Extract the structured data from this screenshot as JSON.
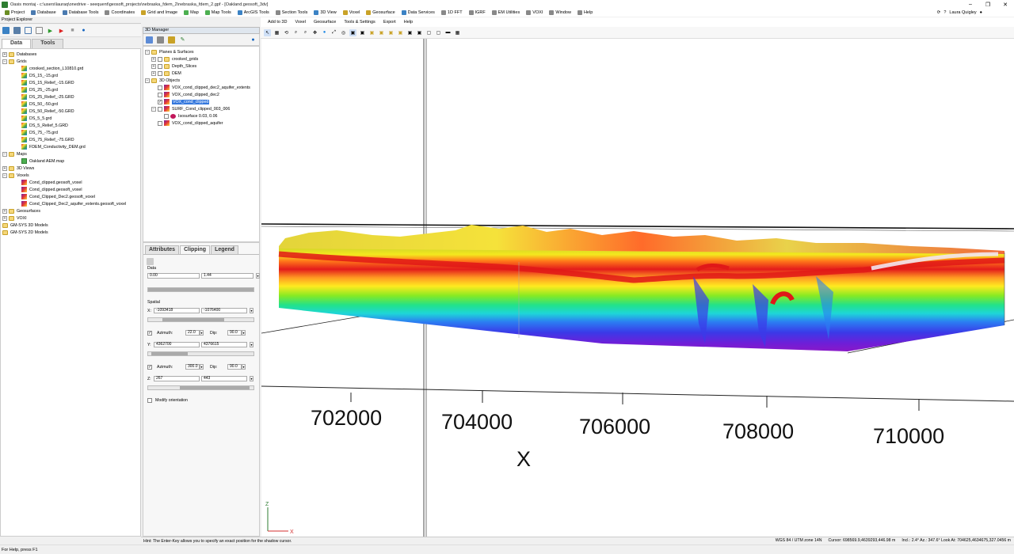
{
  "window": {
    "title": "Oasis montaj - c:\\users\\lauraq\\onedrive - seequent\\geosoft_projects\\nebraska_fdem_2\\nebraska_fdem_2.gpf - [Oakland.geosoft_3dv]",
    "controls": [
      "–",
      "❐",
      "✕"
    ]
  },
  "menu": {
    "items": [
      "Project",
      "Database",
      "Database Tools",
      "Coordinates",
      "Grid and Image",
      "Map",
      "Map Tools",
      "ArcGIS Tools",
      "Section Tools",
      "3D View",
      "Voxel",
      "Geosurface",
      "Data Services",
      "1D FFT",
      "IGRF",
      "EM Utilities",
      "VOXI",
      "Window",
      "Help"
    ],
    "user": "Laura Quigley"
  },
  "project_explorer": {
    "header": "Project Explorer",
    "tabs": [
      "Data",
      "Tools"
    ],
    "tree": [
      {
        "label": "Databases",
        "level": 0,
        "expander": "+",
        "icon": "folder"
      },
      {
        "label": "Grids",
        "level": 0,
        "expander": "−",
        "icon": "folder"
      },
      {
        "label": "crooked_section_L10810.grd",
        "level": 2,
        "icon": "grid"
      },
      {
        "label": "DS_15_-15.grd",
        "level": 2,
        "icon": "grid"
      },
      {
        "label": "DS_15_Relief_-15.GRD",
        "level": 2,
        "icon": "grid"
      },
      {
        "label": "DS_25_-25.grd",
        "level": 2,
        "icon": "grid"
      },
      {
        "label": "DS_25_Relief_-25.GRD",
        "level": 2,
        "icon": "grid"
      },
      {
        "label": "DS_50_-50.grd",
        "level": 2,
        "icon": "grid"
      },
      {
        "label": "DS_50_Relief_-50.GRD",
        "level": 2,
        "icon": "grid"
      },
      {
        "label": "DS_5_5.grd",
        "level": 2,
        "icon": "grid"
      },
      {
        "label": "DS_5_Relief_5.GRD",
        "level": 2,
        "icon": "grid"
      },
      {
        "label": "DS_75_-75.grd",
        "level": 2,
        "icon": "grid"
      },
      {
        "label": "DS_75_Relief_-75.GRD",
        "level": 2,
        "icon": "grid"
      },
      {
        "label": "FDEM_Conductivity_DEM.grd",
        "level": 2,
        "icon": "grid"
      },
      {
        "label": "Maps",
        "level": 0,
        "expander": "−",
        "icon": "folder"
      },
      {
        "label": "Oakland AEM.map",
        "level": 2,
        "icon": "map"
      },
      {
        "label": "3D Views",
        "level": 0,
        "expander": "+",
        "icon": "folder"
      },
      {
        "label": "Voxels",
        "level": 0,
        "expander": "−",
        "icon": "folder"
      },
      {
        "label": "Cond_clipped.geosoft_voxel",
        "level": 2,
        "icon": "cube"
      },
      {
        "label": "Cond_clipped.geosoft_voxel",
        "level": 2,
        "icon": "cube"
      },
      {
        "label": "Cond_Clipped_Dec2.geosoft_voxel",
        "level": 2,
        "icon": "cube"
      },
      {
        "label": "Cond_Clipped_Dec2_aquifer_extents.geosoft_voxel",
        "level": 2,
        "icon": "cube"
      },
      {
        "label": "Geosurfaces",
        "level": 0,
        "expander": "+",
        "icon": "folder"
      },
      {
        "label": "VOXI",
        "level": 0,
        "expander": "+",
        "icon": "folder"
      },
      {
        "label": "GM-SYS 3D Models",
        "level": 0,
        "icon": "folder"
      },
      {
        "label": "GM-SYS 2D Models",
        "level": 0,
        "icon": "folder"
      }
    ]
  },
  "manager_3d": {
    "header": "3D Manager",
    "tree": [
      {
        "label": "Planes & Surfaces",
        "level": 0,
        "expander": "−",
        "icon": "folder"
      },
      {
        "label": "crooked_grids",
        "level": 1,
        "expander": "+",
        "check": false,
        "icon": "folder"
      },
      {
        "label": "Depth_Slices",
        "level": 1,
        "expander": "+",
        "check": false,
        "icon": "folder"
      },
      {
        "label": "DEM",
        "level": 1,
        "expander": "+",
        "check": false,
        "icon": "folder"
      },
      {
        "label": "3D Objects",
        "level": 0,
        "expander": "−",
        "icon": "folder"
      },
      {
        "label": "VOX_cond_clipped_dec2_aquifer_extents",
        "level": 1,
        "check": false,
        "icon": "cube"
      },
      {
        "label": "VOX_cond_clipped_dec2",
        "level": 1,
        "check": false,
        "icon": "cube"
      },
      {
        "label": "VOX_cond_clipped",
        "level": 1,
        "check": true,
        "icon": "cube",
        "selected": true
      },
      {
        "label": "SURF_Cond_clipped_003_006",
        "level": 1,
        "expander": "−",
        "check": false,
        "icon": "cube"
      },
      {
        "label": "Isosurface 0.03, 0.06",
        "level": 2,
        "check": false,
        "icon": "iso"
      },
      {
        "label": "VOX_cond_clipped_aquifer",
        "level": 1,
        "check": false,
        "icon": "cube"
      }
    ]
  },
  "props": {
    "tabs": [
      "Attributes",
      "Clipping",
      "Legend"
    ],
    "data_label": "Data",
    "data_min": "0.00",
    "data_max": "1.44",
    "spatial_label": "Spatial",
    "x_label": "X:",
    "x_min": "-1093418",
    "x_max": "-1076400",
    "azimuth_label": "Azimuth:",
    "dip_label": "Dip:",
    "azimuth1": "22.0",
    "dip1": "90.0",
    "y_label": "Y:",
    "y_min": "4362700",
    "y_max": "4376615",
    "azimuth2": "300.0",
    "dip2": "90.0",
    "z_label": "Z:",
    "z_min": "267",
    "z_max": "443",
    "modify_orientation": "Modify orientation"
  },
  "viewport_menu": [
    "Add to 3D",
    "Voxel",
    "Geosurface",
    "Tools & Settings",
    "Export",
    "Help"
  ],
  "viewport": {
    "x_ticks": [
      "702000",
      "704000",
      "706000",
      "708000",
      "710000"
    ],
    "x_axis_title": "X",
    "triad": {
      "z": "Z",
      "x": "X"
    }
  },
  "status": {
    "hint": "Hint: The Enter-Key allows you to specify an exact position for the shadow cursor.",
    "crs": "WGS 84 / UTM zone 14N",
    "cursor": "Cursor: 698569.9,4639293,446.98 m",
    "view": "Incl.: 2.4° Az.: 347.6° Look At: 704625,4634675,327.0456 m"
  },
  "help_text": "For Help, press F1"
}
